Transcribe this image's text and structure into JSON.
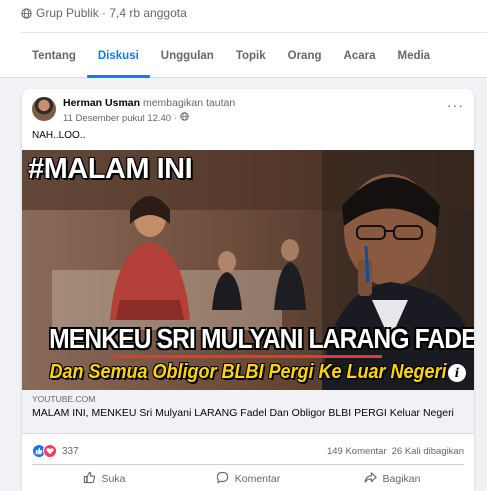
{
  "group": {
    "meta": "Grup Publik · 7,4 rb anggota"
  },
  "tabs": [
    "Tentang",
    "Diskusi",
    "Unggulan",
    "Topik",
    "Orang",
    "Acara",
    "Media"
  ],
  "active_tab": "Diskusi",
  "post": {
    "author": "Herman Usman",
    "action": "membagikan tautan",
    "timestamp": "11 Desember pukul 12.40",
    "privacy_icon": "globe-icon",
    "text": "NAH..LOO..",
    "thumbnail": {
      "caption_top": "#MALAM INI",
      "caption_main": "MENKEU SRI MULYANI LARANG FADEL",
      "caption_sub": "Dan Semua Obligor BLBI Pergi Ke Luar Negeri"
    },
    "link": {
      "domain": "YOUTUBE.COM",
      "title": "MALAM INI, MENKEU Sri Mulyani LARANG Fadel Dan Obligor BLBI PERGI Keluar Negeri"
    },
    "reactions": {
      "count": "337",
      "icons": [
        "like-icon",
        "love-icon"
      ]
    },
    "comments": "149 Komentar",
    "shares": "26 Kali dibagikan",
    "actions": {
      "like": "Suka",
      "comment": "Komentar",
      "share": "Bagikan"
    }
  },
  "colors": {
    "accent": "#1877f2",
    "love": "#f33e58",
    "secondary_text": "#65676b",
    "caption_yellow": "#ffd600",
    "caption_red_bar": "#e53935"
  }
}
